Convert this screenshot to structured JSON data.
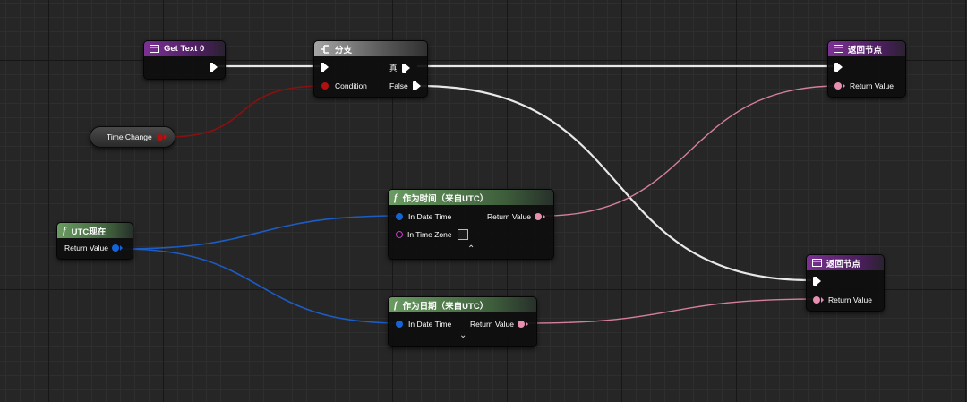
{
  "nodes": {
    "get_text": {
      "title": "Get Text 0"
    },
    "branch": {
      "title": "分支",
      "condition_label": "Condition",
      "true_label": "真",
      "false_label": "False"
    },
    "return_top": {
      "title": "返回节点",
      "return_label": "Return Value"
    },
    "time_change": {
      "label": "Time Change"
    },
    "utc_now": {
      "title": "UTC现在",
      "return_label": "Return Value"
    },
    "as_time": {
      "title": "作为时间（来自UTC）",
      "in_date_label": "In Date Time",
      "in_zone_label": "In Time Zone",
      "return_label": "Return Value"
    },
    "as_date": {
      "title": "作为日期（来自UTC）",
      "in_date_label": "In Date Time",
      "return_label": "Return Value"
    },
    "return_bottom": {
      "title": "返回节点",
      "return_label": "Return Value"
    }
  },
  "icons": {
    "function": "function-icon",
    "branch": "branch-icon",
    "return": "return-node-icon",
    "expand": "chevron-icon"
  },
  "colors": {
    "exec_wire": "#e8e8e8",
    "bool_wire": "#8a1010",
    "struct_wire": "#1c5cc4",
    "text_wire": "#d47f9e",
    "purple_header": "#7b3193",
    "green_header": "#6a9c62"
  }
}
